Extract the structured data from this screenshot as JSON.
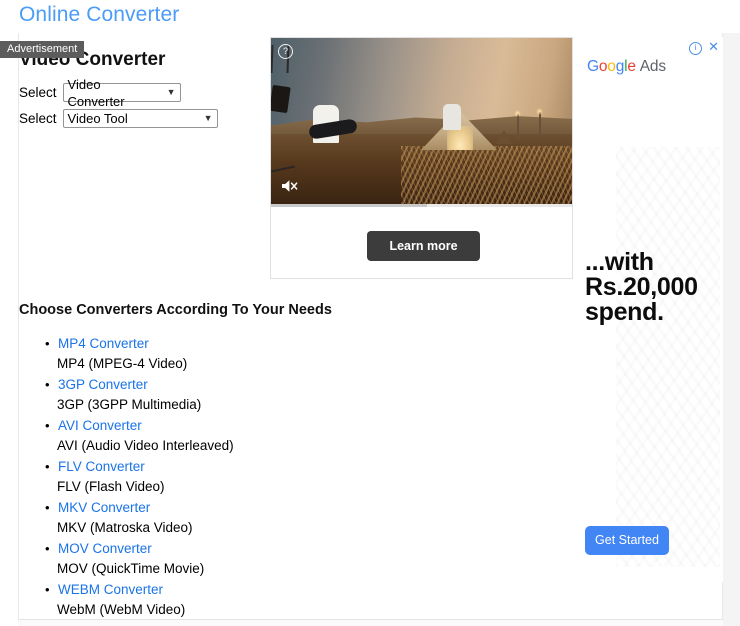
{
  "site": {
    "title": "Online Converter"
  },
  "ad_label": "Advertisement",
  "main": {
    "heading": "Video Converter",
    "selects": [
      {
        "label": "Select",
        "value": "Video Converter",
        "caret": "chevron-down"
      },
      {
        "label": "Select",
        "value": "Video Tool",
        "caret": "chevron-down"
      }
    ],
    "converters_heading": "Choose Converters According To Your Needs",
    "converters": [
      {
        "link": "MP4 Converter",
        "description": "MP4 (MPEG-4 Video)"
      },
      {
        "link": "3GP Converter",
        "description": "3GP (3GPP Multimedia)"
      },
      {
        "link": "AVI Converter",
        "description": "AVI (Audio Video Interleaved)"
      },
      {
        "link": "FLV Converter",
        "description": "FLV (Flash Video)"
      },
      {
        "link": "MKV Converter",
        "description": "MKV (Matroska Video)"
      },
      {
        "link": "MOV Converter",
        "description": "MOV (QuickTime Movie)"
      },
      {
        "link": "WEBM Converter",
        "description": "WebM (WebM Video)"
      }
    ],
    "link_color": "#1a73e8"
  },
  "video_ad": {
    "help_icon": "question-mark-icon",
    "mute_icon": "speaker-muted-icon",
    "help_glyph": "?",
    "cta_label": "Learn more",
    "progress_percent": 52,
    "scene_description": "Desert sunset concert with guitarist, singer and keyboard player in front of a glowing tent"
  },
  "side_ad": {
    "info_icon": "info-icon",
    "info_glyph": "i",
    "close_icon": "close-icon",
    "close_glyph": "✕",
    "brand": {
      "g1": "G",
      "o1": "o",
      "o2": "o",
      "g2": "g",
      "l1": "l",
      "e1": "e",
      "suffix": "Ads"
    },
    "headline_line1": "...with",
    "headline_line2": "Rs.20,000",
    "headline_line3": "spend.",
    "cta_label": "Get Started",
    "cta_color": "#4285f4"
  }
}
